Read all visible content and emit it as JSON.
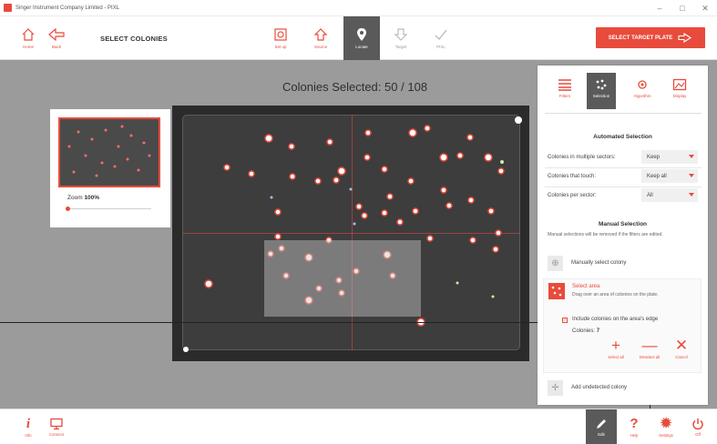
{
  "window": {
    "title": "Singer Instrument Company Limited - PIXL",
    "minimize": "–",
    "maximize": "□",
    "close": "✕"
  },
  "toolbar": {
    "home_label": "Home",
    "back_label": "Back",
    "page_title": "SELECT COLONIES",
    "steps": [
      {
        "label": "Set up",
        "icon": "setup-icon"
      },
      {
        "label": "Source",
        "icon": "source-icon"
      },
      {
        "label": "Locate",
        "icon": "locate-pin-icon"
      },
      {
        "label": "Target",
        "icon": "target-arrow-icon"
      },
      {
        "label": "PIXL",
        "icon": "check-icon"
      }
    ],
    "active_step": "Locate",
    "target_button": "SELECT TARGET PLATE"
  },
  "counter": {
    "prefix": "Colonies Selected:",
    "selected": "50",
    "separator": "/",
    "total": "108"
  },
  "zoom": {
    "label": "Zoom",
    "value": "100%",
    "level_fraction": 0.0
  },
  "panel": {
    "tabs": [
      {
        "label": "Filters",
        "icon": "filters-icon"
      },
      {
        "label": "Selection",
        "icon": "selection-icon"
      },
      {
        "label": "Algorithm",
        "icon": "algorithm-icon"
      },
      {
        "label": "Display",
        "icon": "display-icon"
      }
    ],
    "active_tab": "Selection",
    "automated_heading": "Automated Selection",
    "rows": [
      {
        "label": "Colonies in multiple sectors:",
        "value": "Keep"
      },
      {
        "label": "Colonies that touch:",
        "value": "Keep all"
      },
      {
        "label": "Colonies per sector:",
        "value": "All"
      }
    ],
    "manual_heading": "Manual Selection",
    "manual_note": "Manual selections will be removed if the filters are edited.",
    "manual_select": "Manually select colony",
    "select_area": {
      "title": "Select area",
      "description": "Drag over an area of colonies on the plate.",
      "checkbox_label": "Include colonies on the area's edge",
      "checkbox_checked": true,
      "colonies_label": "Colonies:",
      "colonies_count": "7",
      "select_all": "Select all",
      "deselect_all": "Deselect all",
      "cancel": "Cancel"
    },
    "add_undetected": "Add undetected colony"
  },
  "bottombar": {
    "info_label": "Info",
    "connect_label": "Connect",
    "edit_label": "Edit",
    "help_label": "Help",
    "settings_label": "Settings",
    "off_label": "Off"
  },
  "colors": {
    "accent": "#e84b3c",
    "workarea": "#9b9b9b",
    "active_tab": "#5a5a5a"
  }
}
